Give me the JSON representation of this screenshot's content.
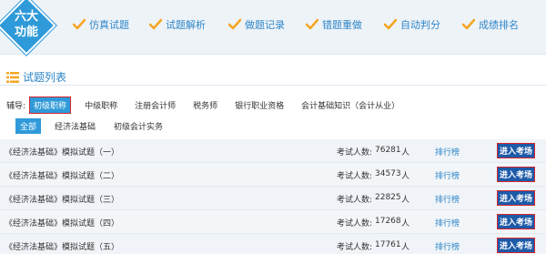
{
  "badge": {
    "line1": "六大",
    "line2": "功能"
  },
  "features": [
    {
      "label": "仿真试题",
      "icon": "check-icon"
    },
    {
      "label": "试题解析",
      "icon": "check-icon"
    },
    {
      "label": "做题记录",
      "icon": "check-icon"
    },
    {
      "label": "错题重做",
      "icon": "check-icon"
    },
    {
      "label": "自动判分",
      "icon": "check-icon"
    },
    {
      "label": "成绩排名",
      "icon": "check-icon"
    }
  ],
  "section": {
    "title": "试题列表",
    "icon": "list-icon"
  },
  "filter": {
    "label": "辅导:",
    "chips": [
      "初级职称",
      "中级职称",
      "注册会计师",
      "税务师",
      "银行职业资格",
      "会计基础知识（会计从业）"
    ]
  },
  "subtabs": [
    "全部",
    "经济法基础",
    "初级会计实务"
  ],
  "exams": [
    {
      "title": "《经济法基础》模拟试题（一）",
      "count_label": "考试人数:",
      "count": "76281",
      "unit": "人",
      "rank": "排行榜",
      "enter": "进入考场"
    },
    {
      "title": "《经济法基础》模拟试题（二）",
      "count_label": "考试人数:",
      "count": "34573",
      "unit": "人",
      "rank": "排行榜",
      "enter": "进入考场"
    },
    {
      "title": "《经济法基础》模拟试题（三）",
      "count_label": "考试人数:",
      "count": "22825",
      "unit": "人",
      "rank": "排行榜",
      "enter": "进入考场"
    },
    {
      "title": "《经济法基础》模拟试题（四）",
      "count_label": "考试人数:",
      "count": "17268",
      "unit": "人",
      "rank": "排行榜",
      "enter": "进入考场"
    },
    {
      "title": "《经济法基础》模拟试题（五）",
      "count_label": "考试人数:",
      "count": "17761",
      "unit": "人",
      "rank": "排行榜",
      "enter": "进入考场"
    }
  ],
  "colors": {
    "accent": "#2f9ad9",
    "link": "#2e86c8",
    "check": "#f5a623",
    "button": "#1d5aa8",
    "highlight_border": "#d9232b"
  }
}
